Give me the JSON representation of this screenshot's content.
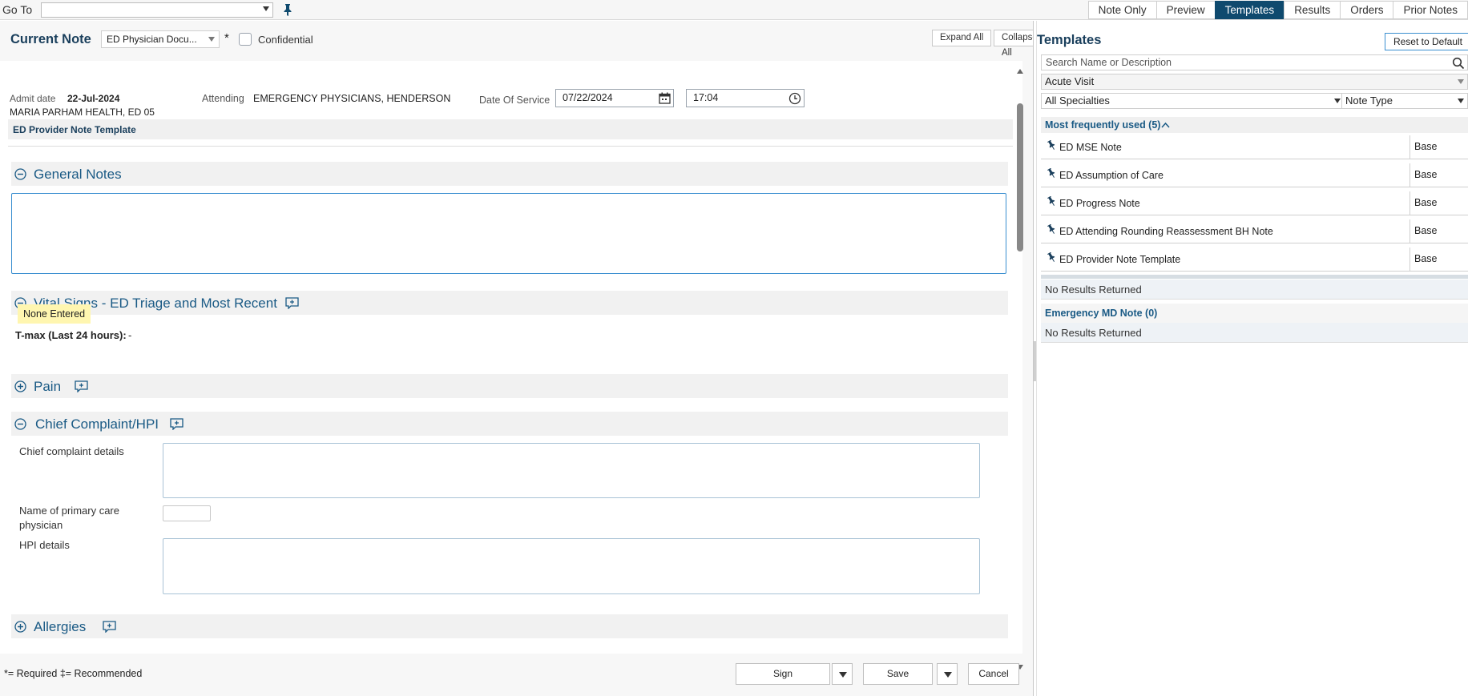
{
  "topbar": {
    "goto_label": "Go To",
    "tabs": [
      "Note Only",
      "Preview",
      "Templates",
      "Results",
      "Orders",
      "Prior Notes"
    ],
    "active_tab": "Templates"
  },
  "current_note": {
    "title": "Current Note",
    "note_type": "ED Physician Docu...",
    "required_marker": "*",
    "confidential_label": "Confidential",
    "expand_all": "Expand All",
    "collapse_all": "Collapse All"
  },
  "header": {
    "admit_label": "Admit date",
    "admit_date": "22-Jul-2024",
    "facility": "MARIA PARHAM HEALTH, ED 05",
    "attending_label": "Attending",
    "attending": "EMERGENCY PHYSICIANS, HENDERSON",
    "dos_label": "Date Of Service",
    "date": "07/22/2024",
    "time": "17:04",
    "template_name": "ED Provider Note Template"
  },
  "sections": {
    "general_notes": "General Notes",
    "vital_signs": "Vital Signs - ED Triage and Most Recent",
    "none_entered": "None Entered",
    "tmax_label": "T-max (Last 24 hours):",
    "tmax_value": "-",
    "pain": "Pain",
    "chief_complaint": "Chief Complaint/HPI",
    "cc_details": "Chief complaint details",
    "pcp_line1": "Name of primary care",
    "pcp_line2": "physician",
    "hpi_details": "HPI details",
    "allergies": "Allergies"
  },
  "footer": {
    "legend": "*= Required  ‡= Recommended",
    "sign": "Sign",
    "save": "Save",
    "cancel": "Cancel"
  },
  "templates": {
    "title": "Templates",
    "reset": "Reset to Default",
    "search_placeholder": "Search Name or Description",
    "visit_type": "Acute Visit",
    "specialty": "All Specialties",
    "note_type": "Note Type",
    "mfu_label": "Most frequently used (5)",
    "mfu_items": [
      {
        "name": "ED MSE Note",
        "type": "Base"
      },
      {
        "name": "ED Assumption of Care",
        "type": "Base"
      },
      {
        "name": "ED Progress Note",
        "type": "Base"
      },
      {
        "name": "ED Attending Rounding Reassessment BH Note",
        "type": "Base"
      },
      {
        "name": "ED Provider Note Template",
        "type": "Base"
      }
    ],
    "no_results_1": "No Results Returned",
    "emergency_group": "Emergency MD Note (0)",
    "no_results_2": "No Results Returned"
  },
  "colors": {
    "accent": "#0f4a6e",
    "section_title": "#1a5a85",
    "highlight": "#fff6b0"
  }
}
